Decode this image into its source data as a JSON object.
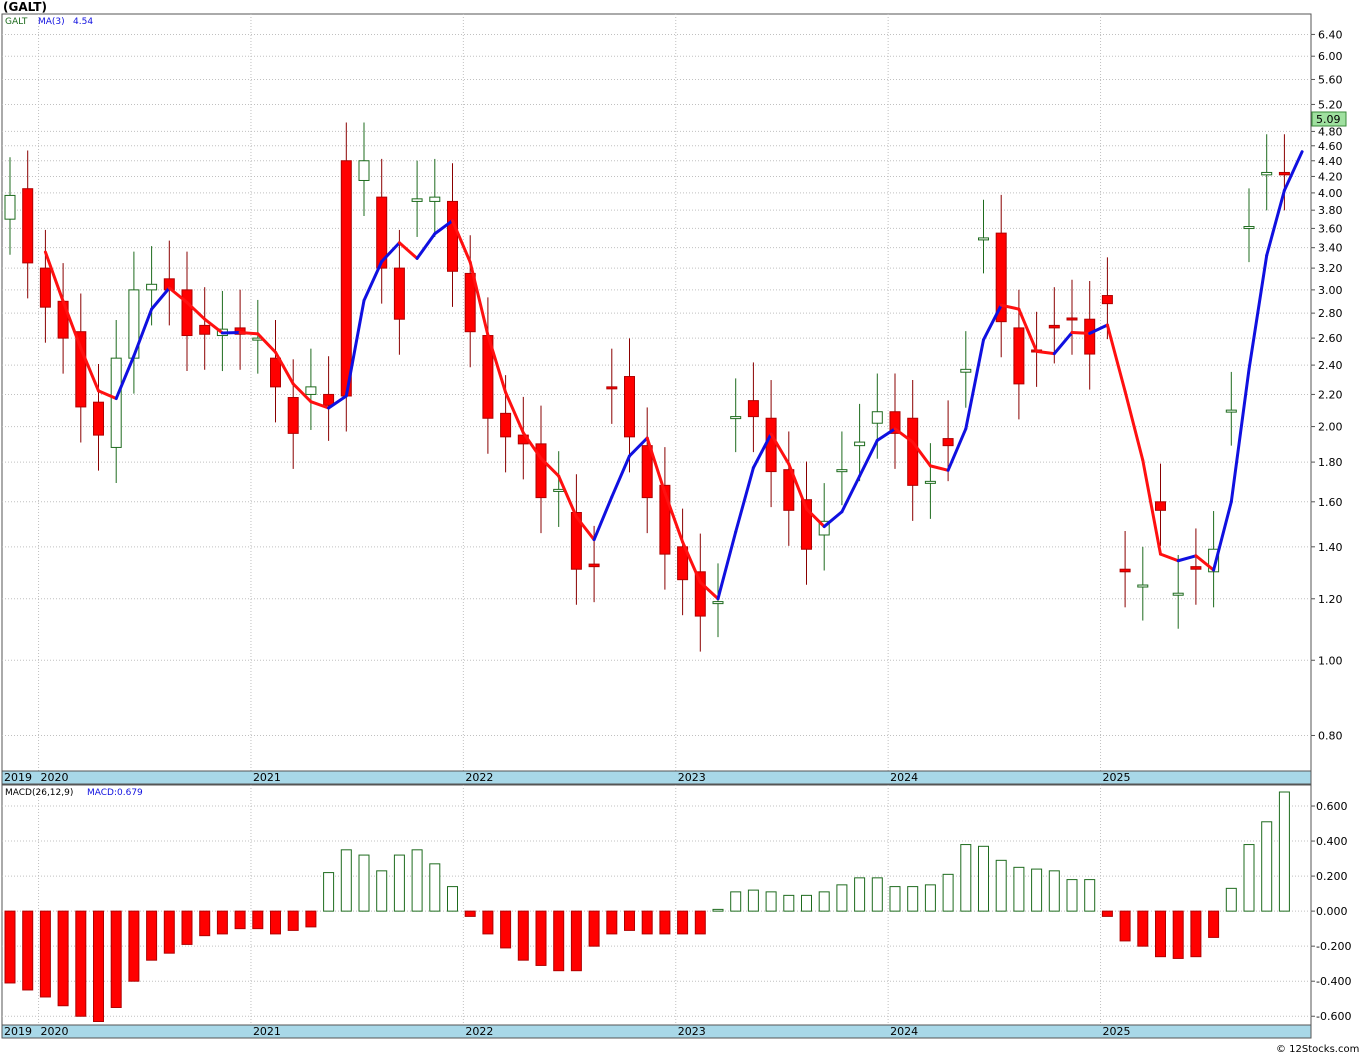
{
  "title": "(GALT)",
  "credit": "© 12Stocks.com",
  "colors": {
    "up_candle_border": "#1e6b1e",
    "down_candle": "#ff0000",
    "ma_up": "#1010e0",
    "ma_down": "#ff1010",
    "grid": "#c0c0c0",
    "axis_strip": "#a8d8e8",
    "last_price_badge": "#9fe09f"
  },
  "price_panel": {
    "legend": {
      "symbol": "GALT",
      "ma_label": "MA(3)",
      "ma_value": "4.54"
    },
    "last_price": "5.09",
    "y_ticks": [
      "6.40",
      "6.00",
      "5.60",
      "5.20",
      "4.80",
      "4.60",
      "4.40",
      "4.20",
      "4.00",
      "3.80",
      "3.60",
      "3.40",
      "3.20",
      "3.00",
      "2.80",
      "2.60",
      "2.40",
      "2.20",
      "2.00",
      "1.80",
      "1.60",
      "1.40",
      "1.20",
      "1.00",
      "0.80"
    ]
  },
  "macd_panel": {
    "legend": {
      "label": "MACD(26,12,9)",
      "value_label": "MACD:0.679"
    },
    "y_ticks": [
      "0.600",
      "0.400",
      "0.200",
      "0.000",
      "-0.200",
      "-0.400",
      "-0.600"
    ]
  },
  "year_labels": [
    "2019",
    "2020",
    "2021",
    "2022",
    "2023",
    "2024",
    "2025"
  ],
  "chart_data": [
    {
      "type": "candlestick",
      "title": "(GALT)",
      "period": "monthly",
      "y_scale": "log",
      "ylim": [
        0.72,
        6.8
      ],
      "x": [
        "2019-11",
        "2019-12",
        "2020-01",
        "2020-02",
        "2020-03",
        "2020-04",
        "2020-05",
        "2020-06",
        "2020-07",
        "2020-08",
        "2020-09",
        "2020-10",
        "2020-11",
        "2020-12",
        "2021-01",
        "2021-02",
        "2021-03",
        "2021-04",
        "2021-05",
        "2021-06",
        "2021-07",
        "2021-08",
        "2021-09",
        "2021-10",
        "2021-11",
        "2021-12",
        "2022-01",
        "2022-02",
        "2022-03",
        "2022-04",
        "2022-05",
        "2022-06",
        "2022-07",
        "2022-08",
        "2022-09",
        "2022-10",
        "2022-11",
        "2022-12",
        "2023-01",
        "2023-02",
        "2023-03",
        "2023-04",
        "2023-05",
        "2023-06",
        "2023-07",
        "2023-08",
        "2023-09",
        "2023-10",
        "2023-11",
        "2023-12",
        "2024-01",
        "2024-02",
        "2024-03",
        "2024-04",
        "2024-05",
        "2024-06",
        "2024-07",
        "2024-08",
        "2024-09",
        "2024-10",
        "2024-11",
        "2024-12",
        "2025-01",
        "2025-02",
        "2025-03",
        "2025-04",
        "2025-05",
        "2025-06",
        "2025-07",
        "2025-08",
        "2025-09",
        "2025-10"
      ],
      "open": [
        3.7,
        4.05,
        3.2,
        2.9,
        2.65,
        2.15,
        1.88,
        2.45,
        3.0,
        3.1,
        3.0,
        2.7,
        2.62,
        2.68,
        2.6,
        2.45,
        2.18,
        2.2,
        2.2,
        4.4,
        4.15,
        3.95,
        3.2,
        3.9,
        3.9,
        3.9,
        3.15,
        2.62,
        2.08,
        1.95,
        1.9,
        1.65,
        1.55,
        1.33,
        2.25,
        2.32,
        1.89,
        1.68,
        1.4,
        1.3,
        1.19,
        2.06,
        2.16,
        2.05,
        1.76,
        1.61,
        1.45,
        1.76,
        1.89,
        2.02,
        2.09,
        2.05,
        1.69,
        1.93,
        2.35,
        3.5,
        3.55,
        2.68,
        2.51,
        2.7,
        2.76,
        2.75,
        2.95,
        1.31,
        1.25,
        1.6,
        1.22,
        1.32,
        1.3,
        2.1,
        3.62,
        4.22,
        4.25
      ],
      "close": [
        3.97,
        3.25,
        2.85,
        2.6,
        2.12,
        1.95,
        2.45,
        3.0,
        3.05,
        3.0,
        2.62,
        2.63,
        2.67,
        2.63,
        2.6,
        2.25,
        1.96,
        2.25,
        2.13,
        2.19,
        4.4,
        3.2,
        2.75,
        3.93,
        3.95,
        3.17,
        2.65,
        2.05,
        1.94,
        1.9,
        1.62,
        1.66,
        1.31,
        1.32,
        2.24,
        1.94,
        1.62,
        1.37,
        1.27,
        1.14,
        1.19,
        2.06,
        2.06,
        1.75,
        1.56,
        1.39,
        1.51,
        1.76,
        1.91,
        2.09,
        1.96,
        1.68,
        1.7,
        1.89,
        2.37,
        3.5,
        2.73,
        2.27,
        2.5,
        2.68,
        2.75,
        2.48,
        2.88,
        1.3,
        1.25,
        1.56,
        1.22,
        1.31,
        1.39,
        2.1,
        3.62,
        4.25,
        4.22,
        5.09
      ],
      "note_ma": "MA(3) overlay, red when falling, blue when rising"
    },
    {
      "type": "bar",
      "title": "MACD(26,12,9)",
      "ylim": [
        -0.65,
        0.72
      ],
      "x": [
        "2019-11",
        "2019-12",
        "2020-01",
        "2020-02",
        "2020-03",
        "2020-04",
        "2020-05",
        "2020-06",
        "2020-07",
        "2020-08",
        "2020-09",
        "2020-10",
        "2020-11",
        "2020-12",
        "2021-01",
        "2021-02",
        "2021-03",
        "2021-04",
        "2021-05",
        "2021-06",
        "2021-07",
        "2021-08",
        "2021-09",
        "2021-10",
        "2021-11",
        "2021-12",
        "2022-01",
        "2022-02",
        "2022-03",
        "2022-04",
        "2022-05",
        "2022-06",
        "2022-07",
        "2022-08",
        "2022-09",
        "2022-10",
        "2022-11",
        "2022-12",
        "2023-01",
        "2023-02",
        "2023-03",
        "2023-04",
        "2023-05",
        "2023-06",
        "2023-07",
        "2023-08",
        "2023-09",
        "2023-10",
        "2023-11",
        "2023-12",
        "2024-01",
        "2024-02",
        "2024-03",
        "2024-04",
        "2024-05",
        "2024-06",
        "2024-07",
        "2024-08",
        "2024-09",
        "2024-10",
        "2024-11",
        "2024-12",
        "2025-01",
        "2025-02",
        "2025-03",
        "2025-04",
        "2025-05",
        "2025-06",
        "2025-07",
        "2025-08",
        "2025-09",
        "2025-10"
      ],
      "values": [
        -0.41,
        -0.45,
        -0.49,
        -0.54,
        -0.6,
        -0.63,
        -0.55,
        -0.4,
        -0.28,
        -0.24,
        -0.19,
        -0.14,
        -0.13,
        -0.1,
        -0.1,
        -0.13,
        -0.11,
        -0.09,
        0.22,
        0.35,
        0.32,
        0.23,
        0.32,
        0.35,
        0.27,
        0.14,
        -0.03,
        -0.13,
        -0.21,
        -0.28,
        -0.31,
        -0.34,
        -0.34,
        -0.2,
        -0.13,
        -0.11,
        -0.13,
        -0.13,
        -0.13,
        -0.13,
        0.01,
        0.11,
        0.12,
        0.11,
        0.09,
        0.09,
        0.11,
        0.15,
        0.19,
        0.19,
        0.14,
        0.14,
        0.15,
        0.21,
        0.38,
        0.37,
        0.29,
        0.25,
        0.24,
        0.23,
        0.18,
        0.18,
        -0.03,
        -0.17,
        -0.2,
        -0.26,
        -0.27,
        -0.26,
        -0.15,
        0.13,
        0.38,
        0.51,
        0.68
      ]
    }
  ]
}
